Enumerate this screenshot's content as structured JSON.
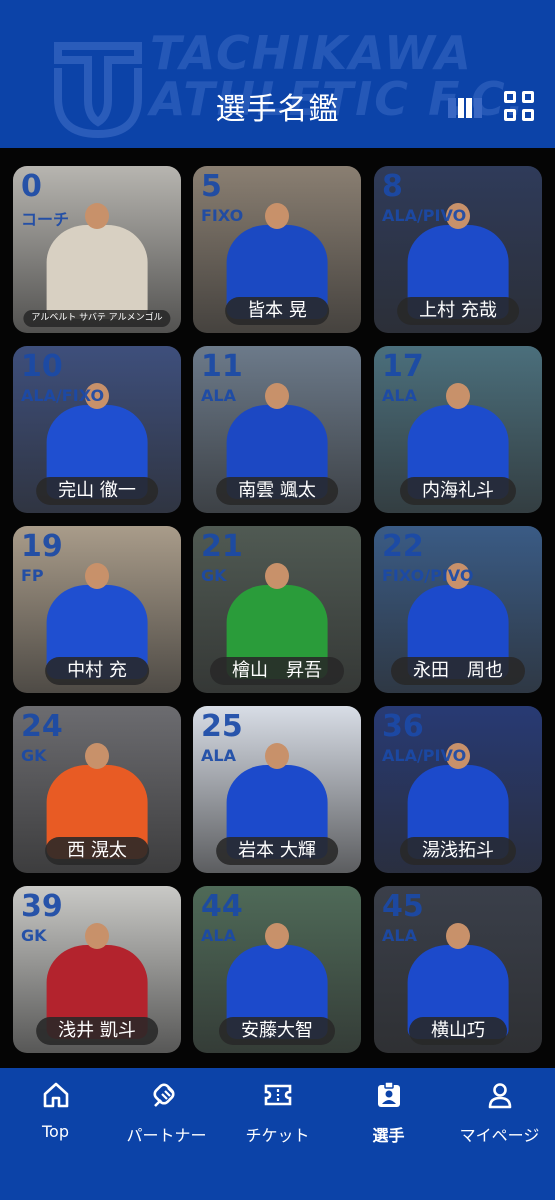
{
  "header": {
    "title": "選手名鑑",
    "watermark": "TACHIKAWA ATHLETIC F.C."
  },
  "players": [
    {
      "number": "0",
      "position": "コーチ",
      "name": "アルベルト サバテ アルメンゴル",
      "bg": "#b7b5b0",
      "kit": "#d8d0c2"
    },
    {
      "number": "5",
      "position": "FIXO",
      "name": "皆本 晃",
      "bg": "#8a7f72",
      "kit": "#1b49c2"
    },
    {
      "number": "8",
      "position": "ALA/PIVO",
      "name": "上村 充哉",
      "bg": "#2f3b5a",
      "kit": "#1d4bc9"
    },
    {
      "number": "10",
      "position": "ALA/FIXO",
      "name": "完山 徹一",
      "bg": "#3e4f7c",
      "kit": "#1f4fd0"
    },
    {
      "number": "11",
      "position": "ALA",
      "name": "南雲 颯太",
      "bg": "#6c7a8a",
      "kit": "#1c48c3"
    },
    {
      "number": "17",
      "position": "ALA",
      "name": "内海礼斗",
      "bg": "#4b6f7c",
      "kit": "#1d4ccc"
    },
    {
      "number": "19",
      "position": "FP",
      "name": "中村 充",
      "bg": "#a99c8a",
      "kit": "#1f4fd0"
    },
    {
      "number": "21",
      "position": "GK",
      "name": "檜山　昇吾",
      "bg": "#505a53",
      "kit": "#2a9c3a"
    },
    {
      "number": "22",
      "position": "FIXO/PIVO",
      "name": "永田　周也",
      "bg": "#3a5b85",
      "kit": "#1c4acb"
    },
    {
      "number": "24",
      "position": "GK",
      "name": "西 滉太",
      "bg": "#6c6c70",
      "kit": "#e85b24"
    },
    {
      "number": "25",
      "position": "ALA",
      "name": "岩本 大輝",
      "bg": "#d8dde6",
      "kit": "#1c4acb"
    },
    {
      "number": "36",
      "position": "ALA/PIVO",
      "name": "湯浅拓斗",
      "bg": "#283a74",
      "kit": "#1c4acb"
    },
    {
      "number": "39",
      "position": "GK",
      "name": "浅井 凱斗",
      "bg": "#c9c9c6",
      "kit": "#b3232d"
    },
    {
      "number": "44",
      "position": "ALA",
      "name": "安藤大智",
      "bg": "#4f6a58",
      "kit": "#1c4acb"
    },
    {
      "number": "45",
      "position": "ALA",
      "name": "横山巧",
      "bg": "#3a3f4a",
      "kit": "#1c4acb"
    }
  ],
  "tabs": [
    {
      "label": "Top",
      "icon": "home-icon"
    },
    {
      "label": "パートナー",
      "icon": "handshake-icon"
    },
    {
      "label": "チケット",
      "icon": "ticket-icon"
    },
    {
      "label": "選手",
      "icon": "id-badge-icon",
      "active": true
    },
    {
      "label": "マイページ",
      "icon": "person-icon"
    }
  ],
  "colors": {
    "brand_blue": "#0c43a8",
    "text_white": "#ffffff",
    "grid_bg": "#050505"
  }
}
